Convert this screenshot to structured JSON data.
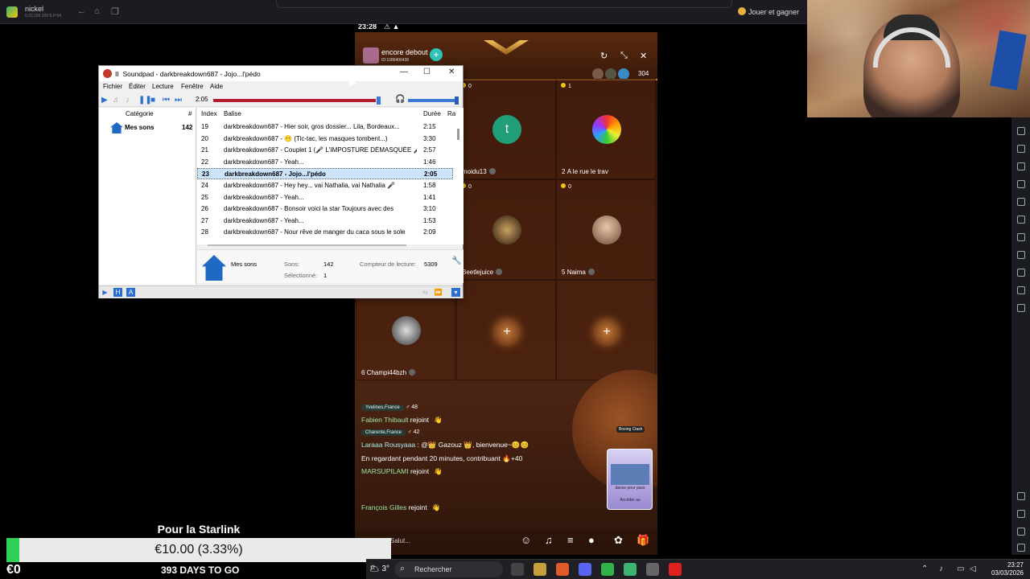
{
  "emulator": {
    "app_name": "nickel",
    "app_ip": "5.33.156.100:5.P:64",
    "play_earn": "Jouer et gagner"
  },
  "phone": {
    "clock": "23:28",
    "room_title": "encore debout",
    "room_id": "ID:1086406436",
    "viewer_count": "304",
    "seats": [
      {
        "num": "",
        "gift": "0",
        "name": "moidu13",
        "avatar_letter": "t",
        "avatar_color": "#1f9e77"
      },
      {
        "num": "2",
        "gift": "1",
        "name": "A le rue le trav",
        "avatar_letter": "",
        "avatar_color": "#d94f6e"
      },
      {
        "num": "",
        "gift": "0",
        "name": "Beetlejuice",
        "avatar_letter": "",
        "avatar_color": "#4a3a2a"
      },
      {
        "num": "5",
        "gift": "0",
        "name": "Naima",
        "avatar_letter": "",
        "avatar_color": "#8a6a5a"
      },
      {
        "num": "6",
        "gift": "",
        "name": "Champi44bzh",
        "avatar_letter": "",
        "avatar_color": "#6a6a6a"
      }
    ],
    "chat": [
      {
        "loc": "Yvelines,France",
        "extra": "♂ 48"
      },
      {
        "name": "Fabien Thibault",
        "text": " rejoint"
      },
      {
        "loc": "Charente,France",
        "extra": "♂ 42"
      },
      {
        "name": "Laraaa Rousyaaa",
        "text": " : @👑 Gazouz 👑, bienvenue~😊😊"
      },
      {
        "name": "",
        "text": "En regardant pendant 20 minutes, contribuant 🔥+40"
      },
      {
        "name": "MARSUPILAMI",
        "text": " rejoint"
      },
      {
        "name": "François Gilles",
        "text": " rejoint"
      }
    ],
    "promo_text": "danse pour pass",
    "promo_sub": "Accéder au",
    "boxing": "Boxing Clash",
    "input_placeholder": "Salut..."
  },
  "soundpad": {
    "title": "Soundpad - darkbreakdown687 - Jojo...l'pédo",
    "menu": [
      "Fichier",
      "Éditer",
      "Lecture",
      "Fenêtre",
      "Aide"
    ],
    "time": "2:05",
    "progress": 0.98,
    "category_header": "Catégorie",
    "count_header": "#",
    "category_name": "Mes sons",
    "category_count": "142",
    "cols": {
      "index": "Index",
      "tag": "Balise",
      "duration": "Durée",
      "extra": "Ra"
    },
    "rows": [
      {
        "idx": "19",
        "tag": "darkbreakdown687 - Hier soir, gros dossier... Lila, Bordeaux...",
        "dur": "2:15"
      },
      {
        "idx": "20",
        "tag": "darkbreakdown687 - 😶 (Tic-tac, les masques tombent...)",
        "dur": "3:30"
      },
      {
        "idx": "21",
        "tag": "darkbreakdown687 - Couplet 1 (🎤 L'IMPOSTURE DÉMASQUÉE 🎤)",
        "dur": "2:57"
      },
      {
        "idx": "22",
        "tag": "darkbreakdown687 - Yeah...",
        "dur": "1:46"
      },
      {
        "idx": "23",
        "tag": "darkbreakdown687 - Jojo...l'pédo",
        "dur": "2:05",
        "selected": true
      },
      {
        "idx": "24",
        "tag": "darkbreakdown687 - Hey hey... vai Nathalia, vai Nathalia 🎤",
        "dur": "1:58"
      },
      {
        "idx": "25",
        "tag": "darkbreakdown687 - Yeah...",
        "dur": "1:41"
      },
      {
        "idx": "26",
        "tag": "darkbreakdown687 - Bonsoir voici la star Toujours avec des",
        "dur": "3:10"
      },
      {
        "idx": "27",
        "tag": "darkbreakdown687 - Yeah...",
        "dur": "1:53"
      },
      {
        "idx": "28",
        "tag": "darkbreakdown687 - Nour rêve de manger du caca sous le sole",
        "dur": "2:09"
      }
    ],
    "info": {
      "name": "Mes sons",
      "sons_label": "Sons:",
      "sons_val": "142",
      "sel_label": "Sélectionné:",
      "sel_val": "1",
      "counter_label": "Compteur de lecture:",
      "counter_val": "5309"
    }
  },
  "donation": {
    "title": "Pour la Starlink",
    "value": "€10.00 (3.33%)",
    "progress": 0.0333,
    "current": "€0",
    "days": "393 DAYS TO GO"
  },
  "taskbar": {
    "weather": "🌥 3°",
    "search": "Rechercher",
    "time": "23:27",
    "date": "03/03/2026"
  }
}
